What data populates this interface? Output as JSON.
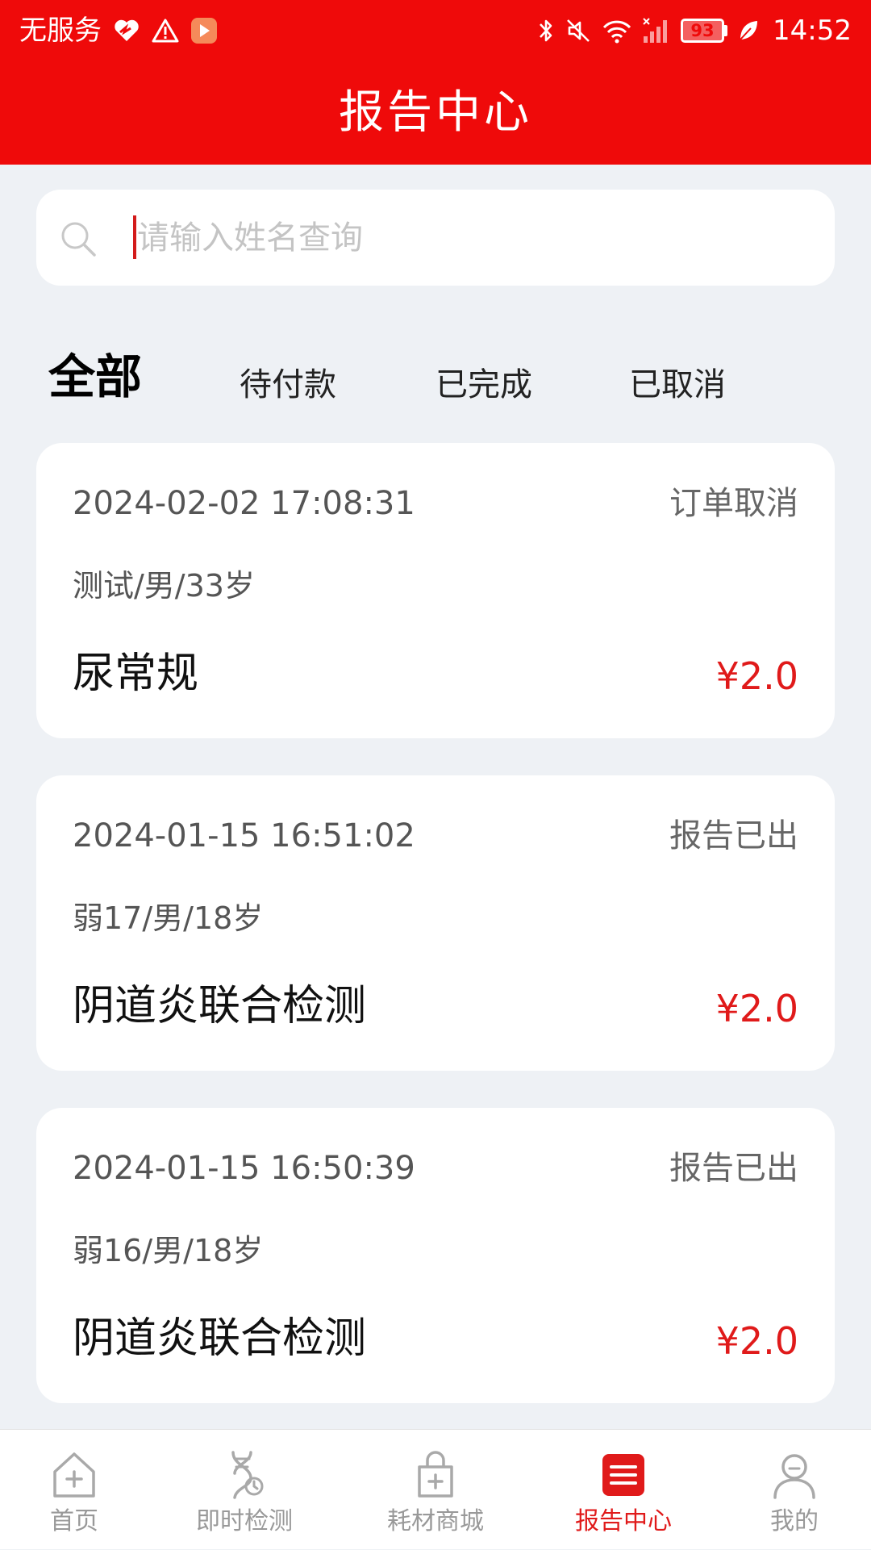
{
  "status_bar": {
    "carrier": "无服务",
    "battery": "93",
    "time": "14:52"
  },
  "header": {
    "title": "报告中心",
    "color": "#ef0a0a"
  },
  "search": {
    "placeholder": "请输入姓名查询",
    "value": ""
  },
  "tabs": [
    {
      "label": "全部",
      "active": true
    },
    {
      "label": "待付款",
      "active": false
    },
    {
      "label": "已完成",
      "active": false
    },
    {
      "label": "已取消",
      "active": false
    }
  ],
  "orders": [
    {
      "datetime": "2024-02-02 17:08:31",
      "status": "订单取消",
      "patient": "测试/男/33岁",
      "item": "尿常规",
      "price": "¥2.0"
    },
    {
      "datetime": "2024-01-15 16:51:02",
      "status": "报告已出",
      "patient": "弱17/男/18岁",
      "item": "阴道炎联合检测",
      "price": "¥2.0"
    },
    {
      "datetime": "2024-01-15 16:50:39",
      "status": "报告已出",
      "patient": "弱16/男/18岁",
      "item": "阴道炎联合检测",
      "price": "¥2.0"
    }
  ],
  "bottom_nav": [
    {
      "label": "首页",
      "icon": "home-plus-icon",
      "active": false
    },
    {
      "label": "即时检测",
      "icon": "dna-test-icon",
      "active": false
    },
    {
      "label": "耗材商城",
      "icon": "shopping-bag-icon",
      "active": false
    },
    {
      "label": "报告中心",
      "icon": "report-list-icon",
      "active": true
    },
    {
      "label": "我的",
      "icon": "user-icon",
      "active": false
    }
  ],
  "colors": {
    "accent": "#ef0a0a",
    "price": "#e01a1a",
    "background": "#eef1f5"
  }
}
